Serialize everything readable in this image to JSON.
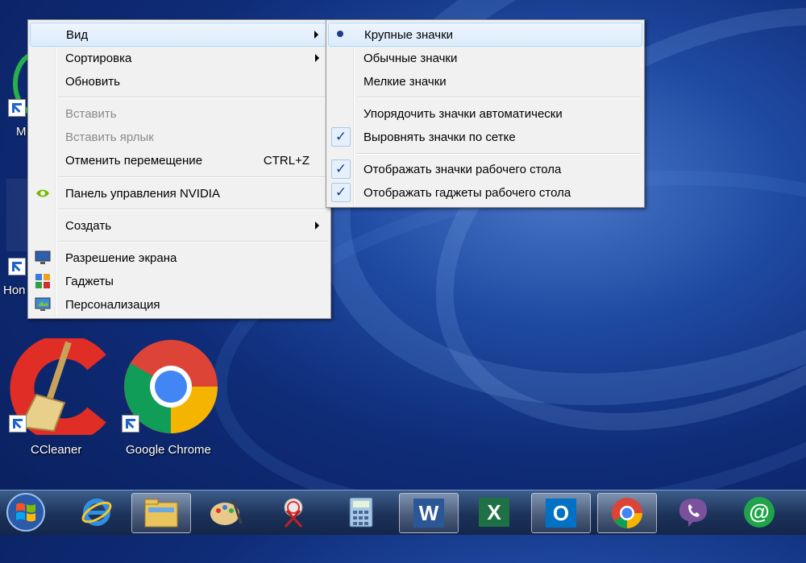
{
  "desktop": {
    "icons": [
      {
        "label": "M"
      },
      {
        "label": "Hon"
      },
      {
        "label": "CCleaner"
      },
      {
        "label": "Google Chrome"
      }
    ]
  },
  "context_menu": {
    "items": [
      {
        "label": "Вид"
      },
      {
        "label": "Сортировка"
      },
      {
        "label": "Обновить"
      },
      {
        "label": "Вставить"
      },
      {
        "label": "Вставить ярлык"
      },
      {
        "label": "Отменить перемещение",
        "shortcut": "CTRL+Z"
      },
      {
        "label": "Панель управления NVIDIA"
      },
      {
        "label": "Создать"
      },
      {
        "label": "Разрешение экрана"
      },
      {
        "label": "Гаджеты"
      },
      {
        "label": "Персонализация"
      }
    ]
  },
  "view_submenu": {
    "items": [
      {
        "label": "Крупные значки",
        "state": "radio-selected"
      },
      {
        "label": "Обычные значки"
      },
      {
        "label": "Мелкие значки"
      },
      {
        "label": "Упорядочить значки автоматически"
      },
      {
        "label": "Выровнять значки по сетке",
        "state": "checked"
      },
      {
        "label": "Отображать значки рабочего стола",
        "state": "checked"
      },
      {
        "label": "Отображать гаджеты  рабочего стола",
        "state": "checked"
      }
    ],
    "check_glyph": "✓"
  },
  "taskbar": {
    "buttons": [
      {
        "icon": "windows-start-icon"
      },
      {
        "icon": "internet-explorer-icon"
      },
      {
        "icon": "file-explorer-icon"
      },
      {
        "icon": "paint-icon"
      },
      {
        "icon": "snipping-tool-icon"
      },
      {
        "icon": "calculator-icon"
      },
      {
        "icon": "word-icon",
        "text": "W"
      },
      {
        "icon": "excel-icon",
        "text": "X"
      },
      {
        "icon": "outlook-icon",
        "text": "O"
      },
      {
        "icon": "chrome-icon"
      },
      {
        "icon": "viber-icon"
      },
      {
        "icon": "mail-agent-icon",
        "text": "@"
      }
    ]
  },
  "colors": {
    "menu_bg": "#f1f1f1",
    "highlight": "#dcebfc",
    "check": "#1b3d8f",
    "ccleaner_red": "#e02d25",
    "word_blue": "#2b5797",
    "excel_green": "#1e7145",
    "outlook_blue": "#0072c6",
    "viber_purple": "#7b519d",
    "agent_green": "#1fa44a"
  }
}
